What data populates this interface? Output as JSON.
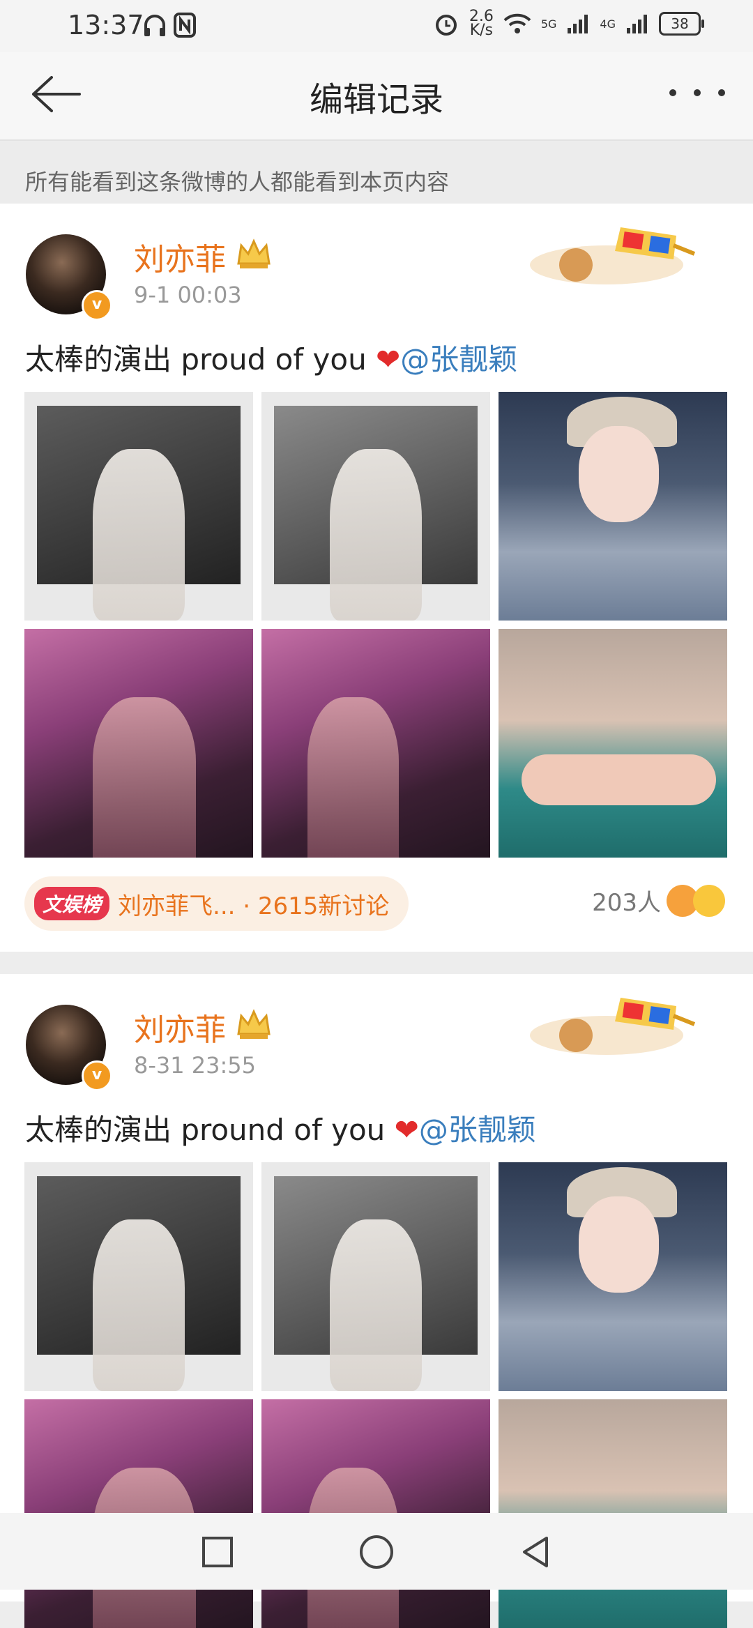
{
  "status_bar": {
    "time": "13:37",
    "net_speed_value": "2.6",
    "net_speed_unit": "K/s",
    "sig1": "5G",
    "sig2": "4G",
    "battery": "38"
  },
  "header": {
    "title": "编辑记录",
    "back_icon": "back-arrow-icon",
    "more_icon": "more-dots-icon"
  },
  "notice": "所有能看到这条微博的人都能看到本页内容",
  "posts": [
    {
      "username": "刘亦菲",
      "time": "9-1 00:03",
      "text_before": "太棒的演出 proud of you ",
      "mention": "@张靓颖",
      "topic_badge": "文娱榜",
      "topic_text": "刘亦菲飞... · 2615新讨论",
      "likes": "203人"
    },
    {
      "username": "刘亦菲",
      "time": "8-31 23:55",
      "text_before": "太棒的演出 pround of you ",
      "mention": "@张靓颖"
    }
  ],
  "colors": {
    "username": "#e8731d",
    "mention": "#3a7ebd",
    "badge": "#e6374d"
  },
  "nav": {
    "recent": "square-icon",
    "home": "circle-icon",
    "back": "triangle-back-icon"
  }
}
